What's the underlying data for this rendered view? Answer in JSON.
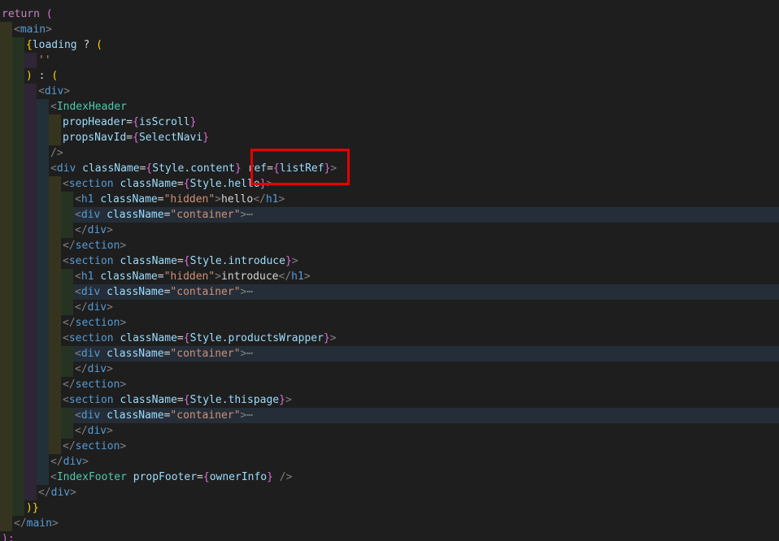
{
  "code_lines": [
    {
      "indent": 0,
      "parts": [
        {
          "t": "return",
          "c": "kw"
        },
        {
          "t": " ",
          "c": "plain"
        },
        {
          "t": "(",
          "c": "brace2"
        }
      ]
    },
    {
      "indent": 1,
      "parts": [
        {
          "t": "<",
          "c": "punc"
        },
        {
          "t": "main",
          "c": "tag"
        },
        {
          "t": ">",
          "c": "punc"
        }
      ]
    },
    {
      "indent": 2,
      "parts": [
        {
          "t": "{",
          "c": "brace"
        },
        {
          "t": "loading",
          "c": "attr"
        },
        {
          "t": " ? ",
          "c": "plain"
        },
        {
          "t": "(",
          "c": "brace"
        }
      ]
    },
    {
      "indent": 3,
      "parts": [
        {
          "t": "''",
          "c": "str"
        }
      ]
    },
    {
      "indent": 2,
      "parts": [
        {
          "t": ")",
          "c": "brace"
        },
        {
          "t": " : ",
          "c": "plain"
        },
        {
          "t": "(",
          "c": "brace"
        }
      ]
    },
    {
      "indent": 3,
      "parts": [
        {
          "t": "<",
          "c": "punc"
        },
        {
          "t": "div",
          "c": "tag"
        },
        {
          "t": ">",
          "c": "punc"
        }
      ]
    },
    {
      "indent": 4,
      "parts": [
        {
          "t": "<",
          "c": "punc"
        },
        {
          "t": "IndexHeader",
          "c": "comp"
        }
      ]
    },
    {
      "indent": 5,
      "parts": [
        {
          "t": "propHeader",
          "c": "attr"
        },
        {
          "t": "=",
          "c": "plain"
        },
        {
          "t": "{",
          "c": "brace2"
        },
        {
          "t": "isScroll",
          "c": "attr"
        },
        {
          "t": "}",
          "c": "brace2"
        }
      ]
    },
    {
      "indent": 5,
      "parts": [
        {
          "t": "propsNavId",
          "c": "attr"
        },
        {
          "t": "=",
          "c": "plain"
        },
        {
          "t": "{",
          "c": "brace2"
        },
        {
          "t": "SelectNavi",
          "c": "attr"
        },
        {
          "t": "}",
          "c": "brace2"
        }
      ]
    },
    {
      "indent": 4,
      "parts": [
        {
          "t": "/>",
          "c": "punc"
        }
      ]
    },
    {
      "indent": 4,
      "parts": [
        {
          "t": "<",
          "c": "punc"
        },
        {
          "t": "div",
          "c": "tag"
        },
        {
          "t": " ",
          "c": "plain"
        },
        {
          "t": "className",
          "c": "attr"
        },
        {
          "t": "=",
          "c": "plain"
        },
        {
          "t": "{",
          "c": "brace2"
        },
        {
          "t": "Style.content",
          "c": "attr"
        },
        {
          "t": "}",
          "c": "brace2"
        },
        {
          "t": " ",
          "c": "plain"
        },
        {
          "t": "ref",
          "c": "attr"
        },
        {
          "t": "=",
          "c": "plain"
        },
        {
          "t": "{",
          "c": "brace2"
        },
        {
          "t": "listRef",
          "c": "attr"
        },
        {
          "t": "}",
          "c": "brace2"
        },
        {
          "t": ">",
          "c": "punc"
        }
      ]
    },
    {
      "indent": 5,
      "parts": [
        {
          "t": "<",
          "c": "punc"
        },
        {
          "t": "section",
          "c": "tag"
        },
        {
          "t": " ",
          "c": "plain"
        },
        {
          "t": "className",
          "c": "attr"
        },
        {
          "t": "=",
          "c": "plain"
        },
        {
          "t": "{",
          "c": "brace2"
        },
        {
          "t": "Style.hello",
          "c": "attr"
        },
        {
          "t": "}",
          "c": "brace2"
        },
        {
          "t": ">",
          "c": "punc"
        }
      ]
    },
    {
      "indent": 6,
      "parts": [
        {
          "t": "<",
          "c": "punc"
        },
        {
          "t": "h1",
          "c": "tag"
        },
        {
          "t": " ",
          "c": "plain"
        },
        {
          "t": "className",
          "c": "attr"
        },
        {
          "t": "=",
          "c": "plain"
        },
        {
          "t": "\"hidden\"",
          "c": "str"
        },
        {
          "t": ">",
          "c": "punc"
        },
        {
          "t": "hello",
          "c": "plain"
        },
        {
          "t": "</",
          "c": "punc"
        },
        {
          "t": "h1",
          "c": "tag"
        },
        {
          "t": ">",
          "c": "punc"
        }
      ]
    },
    {
      "indent": 6,
      "folded": true,
      "parts": [
        {
          "t": "<",
          "c": "punc"
        },
        {
          "t": "div",
          "c": "tag"
        },
        {
          "t": " ",
          "c": "plain"
        },
        {
          "t": "className",
          "c": "attr"
        },
        {
          "t": "=",
          "c": "plain"
        },
        {
          "t": "\"container\"",
          "c": "str"
        },
        {
          "t": ">",
          "c": "punc"
        },
        {
          "t": "⋯",
          "c": "fold"
        }
      ]
    },
    {
      "indent": 6,
      "parts": [
        {
          "t": "</",
          "c": "punc"
        },
        {
          "t": "div",
          "c": "tag"
        },
        {
          "t": ">",
          "c": "punc"
        }
      ]
    },
    {
      "indent": 5,
      "parts": [
        {
          "t": "</",
          "c": "punc"
        },
        {
          "t": "section",
          "c": "tag"
        },
        {
          "t": ">",
          "c": "punc"
        }
      ]
    },
    {
      "indent": 5,
      "parts": [
        {
          "t": "<",
          "c": "punc"
        },
        {
          "t": "section",
          "c": "tag"
        },
        {
          "t": " ",
          "c": "plain"
        },
        {
          "t": "className",
          "c": "attr"
        },
        {
          "t": "=",
          "c": "plain"
        },
        {
          "t": "{",
          "c": "brace2"
        },
        {
          "t": "Style.introduce",
          "c": "attr"
        },
        {
          "t": "}",
          "c": "brace2"
        },
        {
          "t": ">",
          "c": "punc"
        }
      ]
    },
    {
      "indent": 6,
      "parts": [
        {
          "t": "<",
          "c": "punc"
        },
        {
          "t": "h1",
          "c": "tag"
        },
        {
          "t": " ",
          "c": "plain"
        },
        {
          "t": "className",
          "c": "attr"
        },
        {
          "t": "=",
          "c": "plain"
        },
        {
          "t": "\"hidden\"",
          "c": "str"
        },
        {
          "t": ">",
          "c": "punc"
        },
        {
          "t": "introduce",
          "c": "plain"
        },
        {
          "t": "</",
          "c": "punc"
        },
        {
          "t": "h1",
          "c": "tag"
        },
        {
          "t": ">",
          "c": "punc"
        }
      ]
    },
    {
      "indent": 6,
      "folded": true,
      "parts": [
        {
          "t": "<",
          "c": "punc"
        },
        {
          "t": "div",
          "c": "tag"
        },
        {
          "t": " ",
          "c": "plain"
        },
        {
          "t": "className",
          "c": "attr"
        },
        {
          "t": "=",
          "c": "plain"
        },
        {
          "t": "\"container\"",
          "c": "str"
        },
        {
          "t": ">",
          "c": "punc"
        },
        {
          "t": "⋯",
          "c": "fold"
        }
      ]
    },
    {
      "indent": 6,
      "parts": [
        {
          "t": "</",
          "c": "punc"
        },
        {
          "t": "div",
          "c": "tag"
        },
        {
          "t": ">",
          "c": "punc"
        }
      ]
    },
    {
      "indent": 5,
      "parts": [
        {
          "t": "</",
          "c": "punc"
        },
        {
          "t": "section",
          "c": "tag"
        },
        {
          "t": ">",
          "c": "punc"
        }
      ]
    },
    {
      "indent": 5,
      "parts": [
        {
          "t": "<",
          "c": "punc"
        },
        {
          "t": "section",
          "c": "tag"
        },
        {
          "t": " ",
          "c": "plain"
        },
        {
          "t": "className",
          "c": "attr"
        },
        {
          "t": "=",
          "c": "plain"
        },
        {
          "t": "{",
          "c": "brace2"
        },
        {
          "t": "Style.productsWrapper",
          "c": "attr"
        },
        {
          "t": "}",
          "c": "brace2"
        },
        {
          "t": ">",
          "c": "punc"
        }
      ]
    },
    {
      "indent": 6,
      "folded": true,
      "parts": [
        {
          "t": "<",
          "c": "punc"
        },
        {
          "t": "div",
          "c": "tag"
        },
        {
          "t": " ",
          "c": "plain"
        },
        {
          "t": "className",
          "c": "attr"
        },
        {
          "t": "=",
          "c": "plain"
        },
        {
          "t": "\"container\"",
          "c": "str"
        },
        {
          "t": ">",
          "c": "punc"
        },
        {
          "t": "⋯",
          "c": "fold"
        }
      ]
    },
    {
      "indent": 6,
      "parts": [
        {
          "t": "</",
          "c": "punc"
        },
        {
          "t": "div",
          "c": "tag"
        },
        {
          "t": ">",
          "c": "punc"
        }
      ]
    },
    {
      "indent": 5,
      "parts": [
        {
          "t": "</",
          "c": "punc"
        },
        {
          "t": "section",
          "c": "tag"
        },
        {
          "t": ">",
          "c": "punc"
        }
      ]
    },
    {
      "indent": 5,
      "parts": [
        {
          "t": "<",
          "c": "punc"
        },
        {
          "t": "section",
          "c": "tag"
        },
        {
          "t": " ",
          "c": "plain"
        },
        {
          "t": "className",
          "c": "attr"
        },
        {
          "t": "=",
          "c": "plain"
        },
        {
          "t": "{",
          "c": "brace2"
        },
        {
          "t": "Style.thispage",
          "c": "attr"
        },
        {
          "t": "}",
          "c": "brace2"
        },
        {
          "t": ">",
          "c": "punc"
        }
      ]
    },
    {
      "indent": 6,
      "folded": true,
      "parts": [
        {
          "t": "<",
          "c": "punc"
        },
        {
          "t": "div",
          "c": "tag"
        },
        {
          "t": " ",
          "c": "plain"
        },
        {
          "t": "className",
          "c": "attr"
        },
        {
          "t": "=",
          "c": "plain"
        },
        {
          "t": "\"container\"",
          "c": "str"
        },
        {
          "t": ">",
          "c": "punc"
        },
        {
          "t": "⋯",
          "c": "fold"
        }
      ]
    },
    {
      "indent": 6,
      "parts": [
        {
          "t": "</",
          "c": "punc"
        },
        {
          "t": "div",
          "c": "tag"
        },
        {
          "t": ">",
          "c": "punc"
        }
      ]
    },
    {
      "indent": 5,
      "parts": [
        {
          "t": "</",
          "c": "punc"
        },
        {
          "t": "section",
          "c": "tag"
        },
        {
          "t": ">",
          "c": "punc"
        }
      ]
    },
    {
      "indent": 4,
      "parts": [
        {
          "t": "</",
          "c": "punc"
        },
        {
          "t": "div",
          "c": "tag"
        },
        {
          "t": ">",
          "c": "punc"
        }
      ]
    },
    {
      "indent": 4,
      "parts": [
        {
          "t": "<",
          "c": "punc"
        },
        {
          "t": "IndexFooter",
          "c": "comp"
        },
        {
          "t": " ",
          "c": "plain"
        },
        {
          "t": "propFooter",
          "c": "attr"
        },
        {
          "t": "=",
          "c": "plain"
        },
        {
          "t": "{",
          "c": "brace2"
        },
        {
          "t": "ownerInfo",
          "c": "attr"
        },
        {
          "t": "}",
          "c": "brace2"
        },
        {
          "t": " ",
          "c": "plain"
        },
        {
          "t": "/>",
          "c": "punc"
        }
      ]
    },
    {
      "indent": 3,
      "parts": [
        {
          "t": "</",
          "c": "punc"
        },
        {
          "t": "div",
          "c": "tag"
        },
        {
          "t": ">",
          "c": "punc"
        }
      ]
    },
    {
      "indent": 2,
      "parts": [
        {
          "t": ")",
          "c": "brace"
        },
        {
          "t": "}",
          "c": "brace"
        }
      ]
    },
    {
      "indent": 1,
      "parts": [
        {
          "t": "</",
          "c": "punc"
        },
        {
          "t": "main",
          "c": "tag"
        },
        {
          "t": ">",
          "c": "punc"
        }
      ]
    },
    {
      "indent": 0,
      "parts": [
        {
          "t": ");",
          "c": "brace2"
        }
      ]
    }
  ],
  "highlight_annotation": {
    "color": "#e60000",
    "target_text": "ref={listRef}>"
  }
}
